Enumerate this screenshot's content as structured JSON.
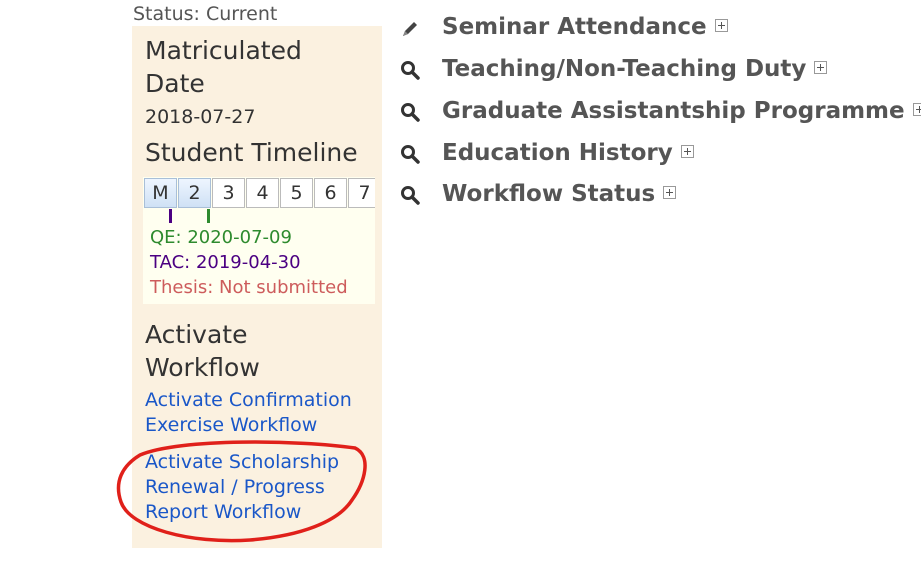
{
  "status": "Status: Current",
  "sidebar": {
    "matriculated_heading_line1": "Matriculated",
    "matriculated_heading_line2": "Date",
    "matriculated_date": "2018-07-27",
    "timeline_heading": "Student Timeline",
    "timeline": {
      "cells": [
        "M",
        "2",
        "3",
        "4",
        "5",
        "6",
        "7"
      ],
      "qe": "QE: 2020-07-09",
      "tac": "TAC: 2019-04-30",
      "thesis": "Thesis: Not submitted"
    },
    "workflow_heading_line1": "Activate",
    "workflow_heading_line2": "Workflow",
    "links": {
      "confirmation_line1": "Activate Confirmation",
      "confirmation_line2": "Exercise Workflow",
      "scholarship_line1": "Activate Scholarship",
      "scholarship_line2": "Renewal / Progress",
      "scholarship_line3": "Report Workflow"
    }
  },
  "menu": {
    "items": [
      {
        "label": "Seminar Attendance",
        "icon": "pencil-icon"
      },
      {
        "label": "Teaching/Non-Teaching Duty",
        "icon": "magnifier-icon"
      },
      {
        "label": "Graduate Assistantship Programme",
        "icon": "magnifier-icon"
      },
      {
        "label": "Education History",
        "icon": "magnifier-icon"
      },
      {
        "label": "Workflow Status",
        "icon": "magnifier-icon"
      }
    ]
  },
  "colors": {
    "sidebar_bg": "#fbf1e0",
    "link": "#1a57c8",
    "qe": "#2e8b2e",
    "tac": "#4b0082",
    "thesis": "#cd5c5c",
    "annotation": "#e0201a"
  }
}
